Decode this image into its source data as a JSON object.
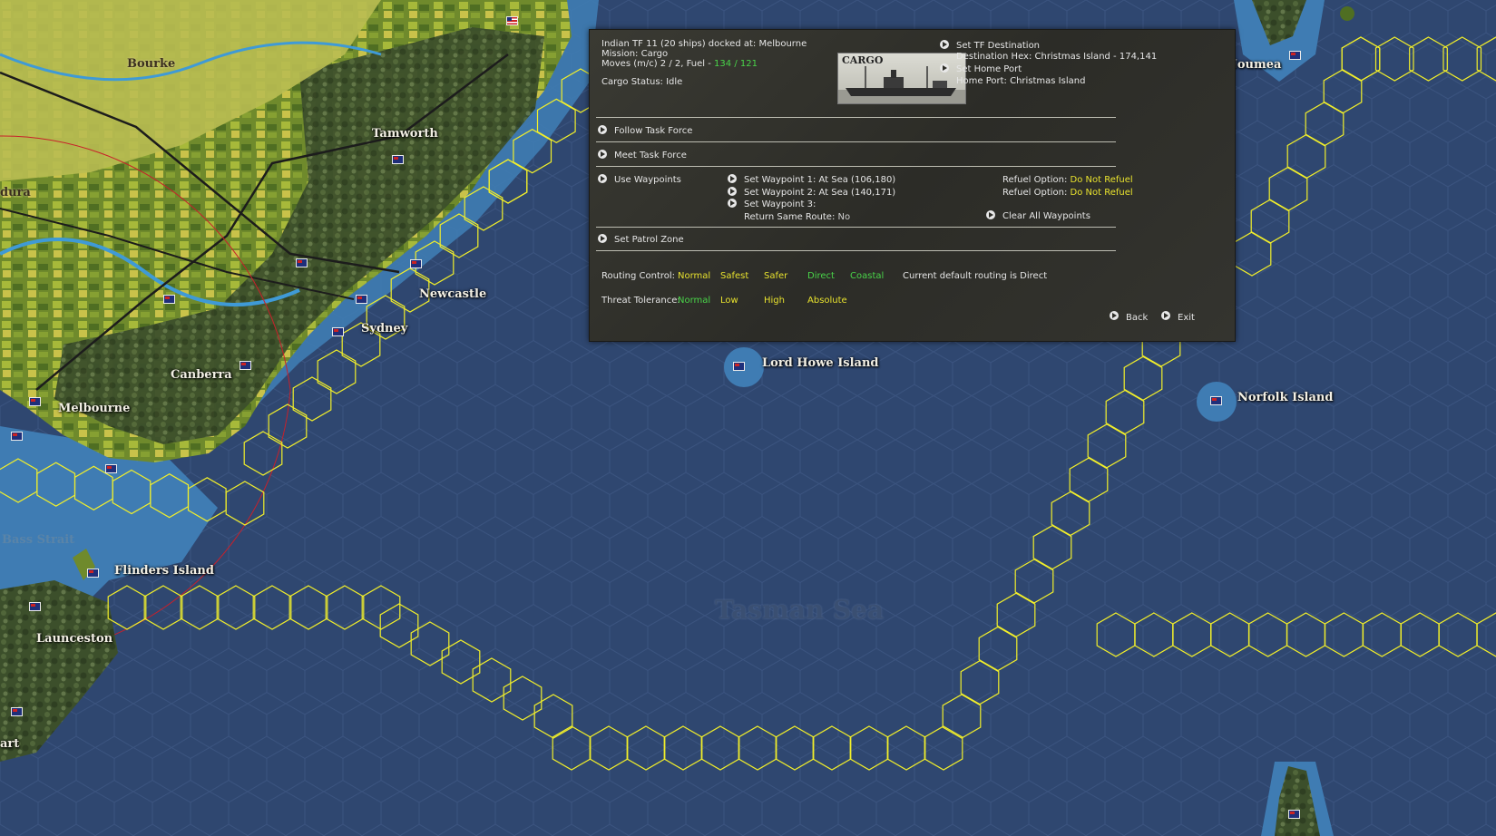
{
  "map": {
    "places": [
      {
        "id": "bourke",
        "label": "Bourke"
      },
      {
        "id": "tamworth",
        "label": "Tamworth"
      },
      {
        "id": "newcastle",
        "label": "Newcastle"
      },
      {
        "id": "sydney",
        "label": "Sydney"
      },
      {
        "id": "canberra",
        "label": "Canberra"
      },
      {
        "id": "melbourne",
        "label": "Melbourne"
      },
      {
        "id": "flinders",
        "label": "Flinders Island"
      },
      {
        "id": "launceston",
        "label": "Launceston"
      },
      {
        "id": "lordhowe",
        "label": "Lord Howe Island"
      },
      {
        "id": "norfolk",
        "label": "Norfolk Island"
      },
      {
        "id": "noumea",
        "label": "Noumea"
      },
      {
        "id": "dura",
        "label": "dura"
      },
      {
        "id": "art",
        "label": "art"
      }
    ],
    "bass_strait": "Bass Strait",
    "sea_name": "Tasman Sea"
  },
  "panel": {
    "tf_line": "Indian TF 11 (20 ships) docked at: Melbourne",
    "mission_line": "Mission: Cargo",
    "moves_prefix": "Moves (m/c) 2 / 2, Fuel - ",
    "fuel_value": "134 / 121",
    "cargo_status": "Cargo Status: Idle",
    "ship_image_label": "CARGO",
    "set_destination": "Set TF Destination",
    "destination_hex": "Destination Hex: Christmas Island - 174,141",
    "set_home_port": "Set Home Port",
    "home_port": "Home Port: Christmas Island",
    "follow_tf": "Follow Task Force",
    "meet_tf": "Meet Task Force",
    "use_waypoints": "Use Waypoints",
    "wp1": "Set Waypoint 1:   At Sea  (106,180)",
    "wp2": "Set Waypoint 2:   At Sea  (140,171)",
    "wp3": "Set Waypoint 3:",
    "return_route_label": "Return Same Route: ",
    "return_route_value": "No",
    "refuel_label": "Refuel Option: ",
    "refuel_value_1": "Do Not Refuel",
    "refuel_value_2": "Do Not Refuel",
    "clear_waypoints": "Clear All Waypoints",
    "set_patrol_zone": "Set Patrol Zone",
    "routing_label": "Routing Control:",
    "routing_options": [
      "Normal",
      "Safest",
      "Safer",
      "Direct",
      "Coastal"
    ],
    "routing_current": "Current default routing is Direct",
    "threat_label": "Threat Tolerance:",
    "threat_options": [
      "Normal",
      "Low",
      "High",
      "Absolute"
    ],
    "back": "Back",
    "exit": "Exit"
  },
  "colors": {
    "sea": "#2f4770",
    "shallow": "#3d7bb4",
    "hex_path": "#f2ef2a",
    "green_text": "#49d449",
    "yellow_text": "#e8e22e"
  }
}
